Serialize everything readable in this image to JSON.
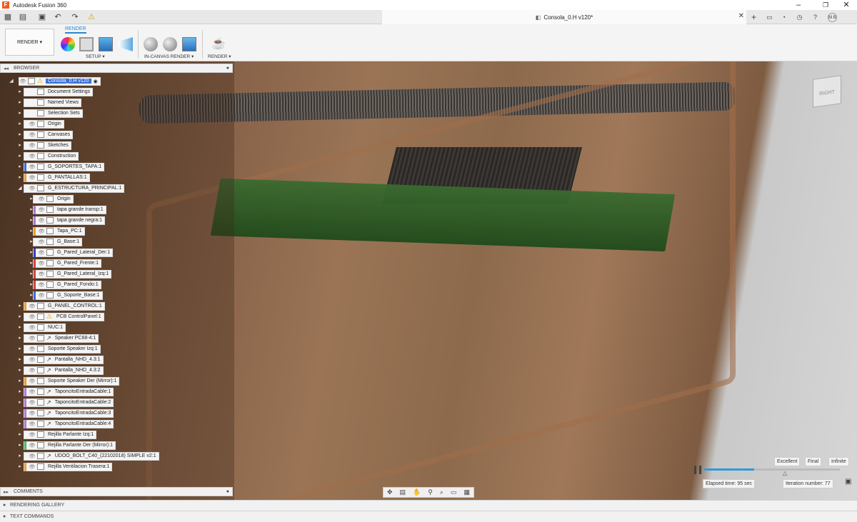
{
  "app": {
    "title": "Autodesk Fusion 360",
    "logo_letter": "F",
    "accent": "#f05a22"
  },
  "window_controls": {
    "minimize": "–",
    "restore": "❐",
    "close": "✕"
  },
  "document_tab": {
    "title": "Consola_0.H v120*",
    "close": "✕"
  },
  "user": {
    "initials": "M B"
  },
  "toolbar": {
    "workspace_label": "RENDER ▾",
    "active_tab": "RENDER",
    "groups": {
      "setup": "SETUP ▾",
      "in_canvas": "IN-CANVAS RENDER ▾",
      "render": "RENDER ▾"
    }
  },
  "browser": {
    "title": "BROWSER",
    "root": "Consola_0.H v120",
    "items": [
      {
        "label": "Document Settings",
        "color": "",
        "eye": false,
        "indent": 1
      },
      {
        "label": "Named Views",
        "color": "",
        "eye": false,
        "indent": 1
      },
      {
        "label": "Selection Sets",
        "color": "",
        "eye": false,
        "indent": 1
      },
      {
        "label": "Origin",
        "color": "",
        "eye": true,
        "indent": 1
      },
      {
        "label": "Canvases",
        "color": "",
        "eye": true,
        "indent": 1
      },
      {
        "label": "Sketches",
        "color": "",
        "eye": true,
        "indent": 1
      },
      {
        "label": "Construction",
        "color": "",
        "eye": true,
        "indent": 1
      },
      {
        "label": "G_SOPORTES_TAPA:1",
        "color": "#3a6fd8",
        "eye": true,
        "indent": 1
      },
      {
        "label": "G_PANTALLAS:1",
        "color": "#e3a23b",
        "eye": true,
        "indent": 1
      },
      {
        "label": "G_ESTRUCTURA_PRINCIPAL:1",
        "color": "",
        "eye": true,
        "indent": 1,
        "expanded": true
      },
      {
        "label": "Origin",
        "color": "",
        "eye": true,
        "indent": 2
      },
      {
        "label": "tapa grande transp:1",
        "color": "#b07ad8",
        "eye": true,
        "indent": 2
      },
      {
        "label": "tapa grande negra:1",
        "color": "#b07ad8",
        "eye": true,
        "indent": 2
      },
      {
        "label": "Tapa_PC:1",
        "color": "#e8a030",
        "eye": true,
        "indent": 2
      },
      {
        "label": "G_Base:1",
        "color": "",
        "eye": true,
        "indent": 2
      },
      {
        "label": "G_Pared_Lateral_Der:1",
        "color": "#3040c8",
        "eye": true,
        "indent": 2
      },
      {
        "label": "G_Pared_Frente:1",
        "color": "#d84040",
        "eye": true,
        "indent": 2
      },
      {
        "label": "G_Pared_Lateral_Izq:1",
        "color": "#d84040",
        "eye": true,
        "indent": 2
      },
      {
        "label": "G_Pared_Fondo:1",
        "color": "#d84040",
        "eye": true,
        "indent": 2
      },
      {
        "label": "G_Soporte_Base:1",
        "color": "#3a6fd8",
        "eye": true,
        "indent": 2
      },
      {
        "label": "G_PANEL_CONTROL:1",
        "color": "#e3a23b",
        "eye": true,
        "indent": 1
      },
      {
        "label": "PCB ControlPanel:1",
        "color": "",
        "eye": true,
        "indent": 1,
        "warn": true
      },
      {
        "label": "NUC:1",
        "color": "",
        "eye": true,
        "indent": 1
      },
      {
        "label": "Speaker PC68-4:1",
        "color": "",
        "eye": true,
        "indent": 1,
        "link": true
      },
      {
        "label": "Soporte Speaker Izq:1",
        "color": "",
        "eye": true,
        "indent": 1
      },
      {
        "label": "Pantalla_NHD_4.3:1",
        "color": "",
        "eye": true,
        "indent": 1,
        "link": true
      },
      {
        "label": "Pantalla_NHD_4.3:2",
        "color": "",
        "eye": true,
        "indent": 1,
        "link": true
      },
      {
        "label": "Soporte Speaker Der (Mirror):1",
        "color": "#e8a030",
        "eye": true,
        "indent": 1
      },
      {
        "label": "TaponcitoEntradaCable:1",
        "color": "#b07ad8",
        "eye": true,
        "indent": 1,
        "link": true
      },
      {
        "label": "TaponcitoEntradaCable:2",
        "color": "#b07ad8",
        "eye": true,
        "indent": 1,
        "link": true
      },
      {
        "label": "TaponcitoEntradaCable:3",
        "color": "#b07ad8",
        "eye": true,
        "indent": 1,
        "link": true
      },
      {
        "label": "TaponcitoEntradaCable:4",
        "color": "#b07ad8",
        "eye": true,
        "indent": 1,
        "link": true
      },
      {
        "label": "Rejilla Parlante Izq:1",
        "color": "",
        "eye": true,
        "indent": 1
      },
      {
        "label": "Rejilla Parlante Der (Mirror):1",
        "color": "#40c060",
        "eye": true,
        "indent": 1
      },
      {
        "label": "UDOO_BOLT_C40_(22102018) SIMPLE v2:1",
        "color": "",
        "eye": true,
        "indent": 1,
        "link": true
      },
      {
        "label": "Rejilla Ventilacion Trasera:1",
        "color": "#e3a23b",
        "eye": true,
        "indent": 1
      }
    ]
  },
  "comments": {
    "title": "COMMENTS"
  },
  "viewcube": {
    "face": "RIGHT"
  },
  "render_status": {
    "quality_options": [
      "Excellent",
      "Final",
      "Infinite"
    ],
    "elapsed": "Elapsed time: 95 sec",
    "iteration": "Iteration number: 77",
    "progress": 0.37
  },
  "bottom_panels": {
    "gallery": "RENDERING GALLERY",
    "text_commands": "TEXT COMMANDS"
  }
}
